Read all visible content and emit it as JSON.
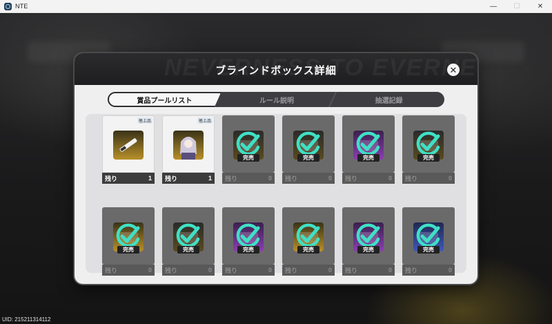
{
  "window": {
    "title": "NTE",
    "controls": [
      "—",
      "☐",
      "✕"
    ]
  },
  "background": {
    "uid_text": "UID: 215211314112",
    "header_deco_text": "NEVERNESS TO EVERNESS"
  },
  "modal": {
    "title": "ブラインドボックス詳細",
    "close_symbol": "✕",
    "tabs": [
      {
        "label": "賞品プールリスト",
        "active": true
      },
      {
        "label": "ルール説明",
        "active": false
      },
      {
        "label": "抽選記録",
        "active": false
      }
    ],
    "remaining_label": "残り",
    "sold_out_label": "完売",
    "rank_label": "極上品",
    "items": [
      {
        "remaining": "1",
        "sold_out": false,
        "rank": true,
        "icon": "knife-icon",
        "tone": "gold"
      },
      {
        "remaining": "1",
        "sold_out": false,
        "rank": true,
        "icon": "character-portrait-icon",
        "tone": "gold"
      },
      {
        "remaining": "0",
        "sold_out": true,
        "icon": "item-icon",
        "tone": "dark"
      },
      {
        "remaining": "0",
        "sold_out": true,
        "icon": "item-icon",
        "tone": "dark"
      },
      {
        "remaining": "0",
        "sold_out": true,
        "icon": "item-icon",
        "tone": "purple"
      },
      {
        "remaining": "0",
        "sold_out": true,
        "icon": "item-icon",
        "tone": "dark"
      },
      {
        "remaining": "0",
        "sold_out": true,
        "icon": "item-icon",
        "tone": "gold"
      },
      {
        "remaining": "0",
        "sold_out": true,
        "icon": "item-icon",
        "tone": "dark"
      },
      {
        "remaining": "0",
        "sold_out": true,
        "icon": "item-icon",
        "tone": "purple"
      },
      {
        "remaining": "0",
        "sold_out": true,
        "icon": "item-icon",
        "tone": "gold"
      },
      {
        "remaining": "0",
        "sold_out": true,
        "icon": "item-icon",
        "tone": "purple"
      },
      {
        "remaining": "0",
        "sold_out": true,
        "icon": "item-icon",
        "tone": "blue"
      }
    ]
  },
  "colors": {
    "check_accent": "#3fe0c5",
    "modal_header": "#232325",
    "modal_body": "#efefef"
  }
}
